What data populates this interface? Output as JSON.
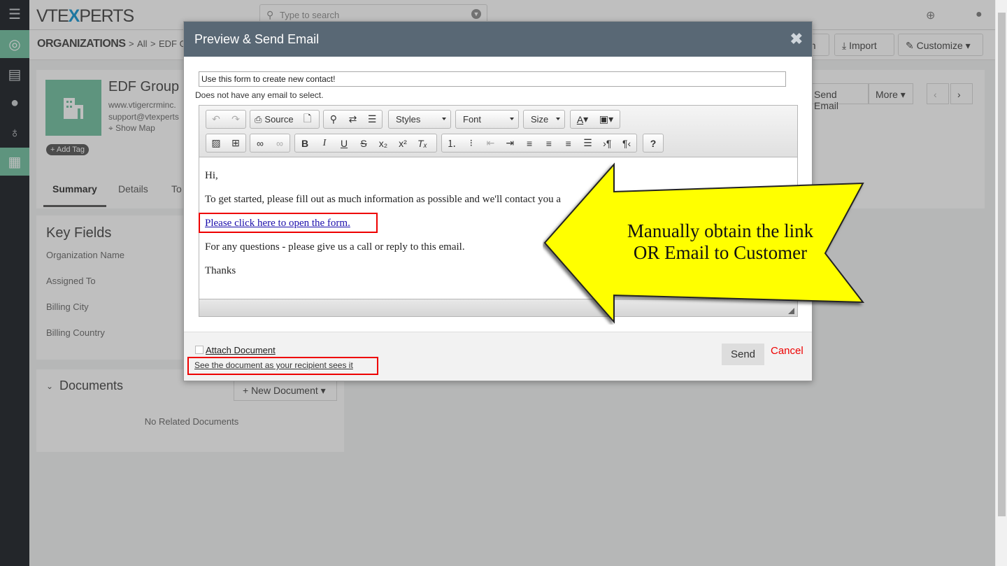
{
  "app": {
    "logo_left": "VT",
    "logo_mid": "E",
    "logo_x": "X",
    "logo_right": "PERTS",
    "search_placeholder": "Type to search"
  },
  "breadcrumb": {
    "module": "ORGANIZATIONS",
    "sep1": ">",
    "all": "All",
    "sep2": ">",
    "record": "EDF Group"
  },
  "header_buttons": {
    "partial": "on",
    "import": "Import",
    "customize": "Customize"
  },
  "record": {
    "name": "EDF Group",
    "website": "www.vtigercrminc.",
    "email": "support@vtexperts",
    "show_map": "Show Map",
    "add_tag": "+ Add Tag",
    "send_email": "Send Email",
    "more": "More"
  },
  "tabs": [
    "Summary",
    "Details",
    "To"
  ],
  "key_fields": {
    "title": "Key Fields",
    "labels": [
      "Organization Name",
      "Assigned To",
      "Billing City",
      "Billing Country"
    ]
  },
  "documents": {
    "title": "Documents",
    "new_button": "+ New Document",
    "empty": "No Related Documents"
  },
  "modal": {
    "title": "Preview & Send Email",
    "close": "✖",
    "subject": "Use this form to create new contact!",
    "no_email": "Does not have any email to select.",
    "toolbar": {
      "source": "Source",
      "styles": "Styles",
      "font": "Font",
      "size": "Size"
    },
    "body": {
      "greeting": "Hi,",
      "line1": "To get started, please fill out as much information as possible and we'll contact you a",
      "link": "Please click here to open the form.",
      "line2": "For any questions - please give us a call or reply to this email.",
      "sign": "Thanks"
    },
    "footer": {
      "attach_label": "Attach Document",
      "recipient_link": "See the document as your recipient sees it",
      "send": "Send",
      "cancel": "Cancel"
    }
  },
  "callout": {
    "line1": "Manually obtain the link",
    "line2": "OR Email to Customer",
    "fill": "#ffff00"
  },
  "colors": {
    "modal_header": "#596875",
    "accent_green": "#7ec6a9",
    "highlight_red": "#ee0000"
  }
}
